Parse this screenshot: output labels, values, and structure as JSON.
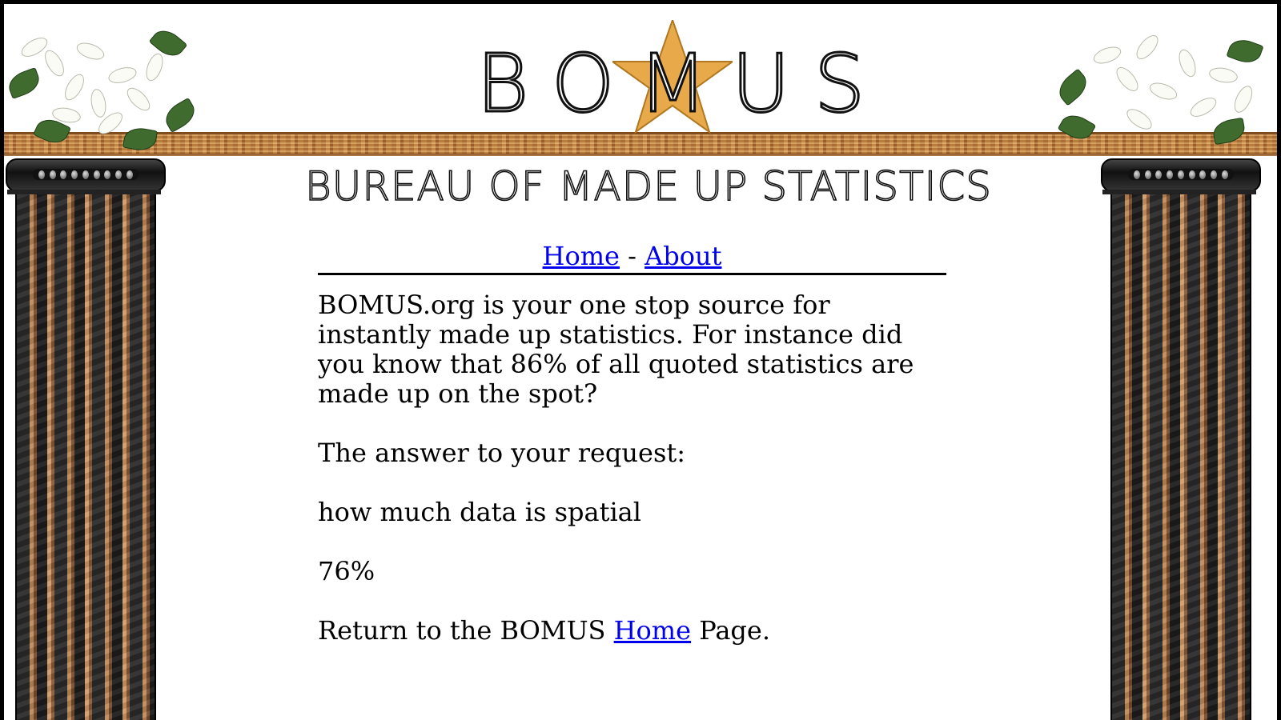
{
  "site": {
    "logo_text": "BOMUS",
    "subtitle": "BUREAU OF MADE UP STATISTICS"
  },
  "nav": {
    "home_label": "Home",
    "separator": "-",
    "about_label": "About"
  },
  "content": {
    "intro": "BOMUS.org is your one stop source for instantly made up statistics. For instance did you know that 86% of all quoted statistics are made up on the spot?",
    "answer_heading": "The answer to your request:",
    "query": "how much data is spatial",
    "result": "76%",
    "return_prefix": "Return to the BOMUS",
    "return_link": "Home",
    "return_suffix": "Page."
  },
  "icons": {
    "star": "star-icon",
    "flowers": "lily-flowers-decoration",
    "pillars": "marble-pillar"
  },
  "colors": {
    "link": "#0000ee",
    "star": "#e8a94a",
    "beam": "#c08040"
  }
}
